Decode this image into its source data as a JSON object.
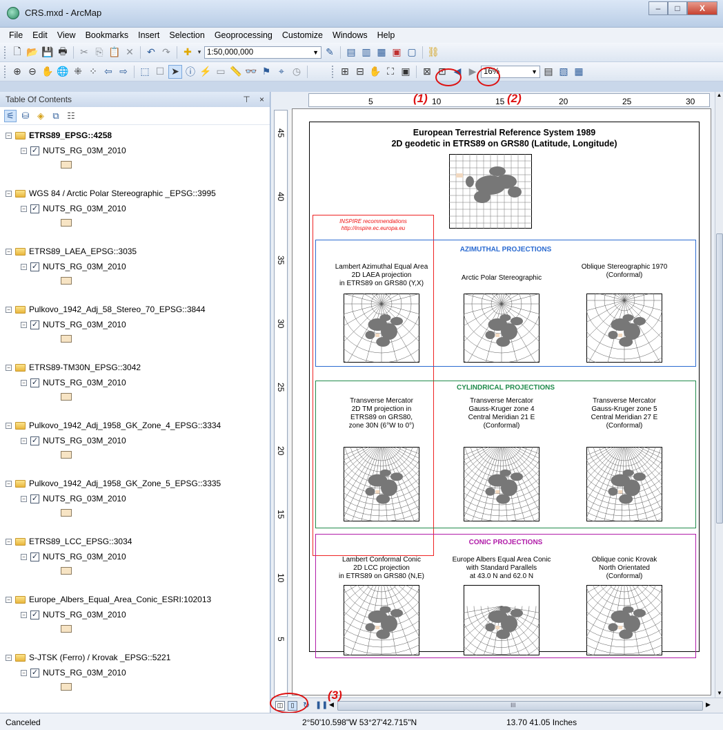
{
  "window": {
    "title": "CRS.mxd - ArcMap",
    "minimize": "–",
    "maximize": "□",
    "close": "X"
  },
  "menu": [
    "File",
    "Edit",
    "View",
    "Bookmarks",
    "Insert",
    "Selection",
    "Geoprocessing",
    "Customize",
    "Windows",
    "Help"
  ],
  "toolbar": {
    "scale_value": "1:50,000,000",
    "zoom_value": "16%"
  },
  "toc": {
    "title": "Table Of Contents",
    "pin": "ᵖ",
    "close": "×",
    "layers": [
      {
        "name": "ETRS89_EPSG::4258",
        "bold": true,
        "sublayer": "NUTS_RG_03M_2010"
      },
      {
        "name": "WGS 84 / Arctic Polar Stereographic _EPSG::3995",
        "bold": false,
        "sublayer": "NUTS_RG_03M_2010"
      },
      {
        "name": "ETRS89_LAEA_EPSG::3035",
        "bold": false,
        "sublayer": "NUTS_RG_03M_2010"
      },
      {
        "name": "Pulkovo_1942_Adj_58_Stereo_70_EPSG::3844",
        "bold": false,
        "sublayer": "NUTS_RG_03M_2010"
      },
      {
        "name": "ETRS89-TM30N_EPSG::3042",
        "bold": false,
        "sublayer": "NUTS_RG_03M_2010"
      },
      {
        "name": "Pulkovo_1942_Adj_1958_GK_Zone_4_EPSG::3334",
        "bold": false,
        "sublayer": "NUTS_RG_03M_2010"
      },
      {
        "name": "Pulkovo_1942_Adj_1958_GK_Zone_5_EPSG::3335",
        "bold": false,
        "sublayer": "NUTS_RG_03M_2010"
      },
      {
        "name": "ETRS89_LCC_EPSG::3034",
        "bold": false,
        "sublayer": "NUTS_RG_03M_2010"
      },
      {
        "name": "Europe_Albers_Equal_Area_Conic_ESRI:102013",
        "bold": false,
        "sublayer": "NUTS_RG_03M_2010"
      },
      {
        "name": "S-JTSK (Ferro) / Krovak _EPSG::5221",
        "bold": false,
        "sublayer": "NUTS_RG_03M_2010"
      }
    ]
  },
  "rulers": {
    "horizontal": [
      "5",
      "10",
      "15",
      "20",
      "25",
      "30"
    ],
    "vertical": [
      "45",
      "40",
      "35",
      "30",
      "25",
      "20",
      "15",
      "10",
      "5"
    ]
  },
  "layout": {
    "title_line1": "European Terrestrial Reference System 1989",
    "title_line2": "2D geodetic in ETRS89 on GRS80 (Latitude, Longitude)",
    "inspire_line1": "INSPIRE recommendations",
    "inspire_line2": "http://inspire.ec.europa.eu",
    "azimuthal": {
      "title": "AZIMUTHAL PROJECTIONS",
      "color": "#2a6ad0",
      "maps": [
        {
          "label": "Lambert Azimuthal Equal Area\n2D LAEA projection\nin ETRS89 on GRS80 (Y,X)"
        },
        {
          "label": "Arctic Polar Stereographic"
        },
        {
          "label": "Oblique Stereographic 1970\n(Conformal)"
        }
      ]
    },
    "cylindrical": {
      "title": "CYLINDRICAL PROJECTIONS",
      "color": "#1f8a4a",
      "maps": [
        {
          "label": "Transverse Mercator\n2D TM projection in\nETRS89 on GRS80,\nzone 30N (6°W to 0°)"
        },
        {
          "label": "Transverse Mercator\nGauss-Kruger zone 4\nCentral Meridian 21 E\n(Conformal)"
        },
        {
          "label": "Transverse Mercator\nGauss-Kruger zone 5\nCentral Meridian 27 E\n(Conformal)"
        }
      ]
    },
    "conic": {
      "title": "CONIC PROJECTIONS",
      "color": "#b01aa8",
      "maps": [
        {
          "label": "Lambert Conformal Conic\n2D LCC projection\nin ETRS89 on GRS80 (N,E)"
        },
        {
          "label": "Europe Albers Equal Area Conic\nwith Standard Parallels\nat 43.0 N and 62.0 N"
        },
        {
          "label": "Oblique conic Krovak\nNorth Orientated\n(Conformal)"
        }
      ]
    }
  },
  "annotations": [
    "(1)",
    "(2)",
    "(3)"
  ],
  "scrollbar": {
    "center_mark": "III"
  },
  "status": {
    "left": "Canceled",
    "coords": "2°50'10.598\"W  53°27'42.715\"N",
    "size": "13.70  41.05 Inches"
  }
}
